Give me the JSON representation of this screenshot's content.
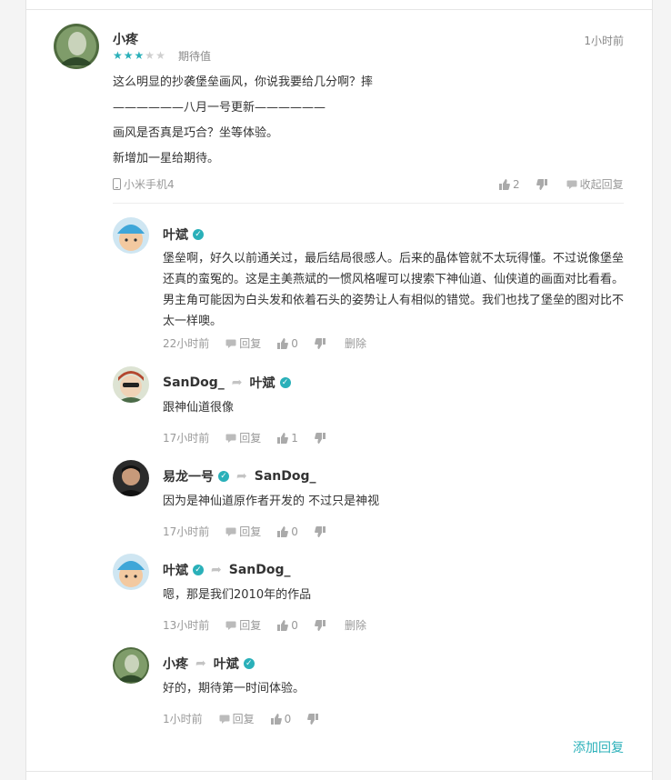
{
  "main_comment": {
    "author": "小疼",
    "time": "1小时前",
    "rating": 3,
    "rating_max": 5,
    "rating_label": "期待值",
    "lines": [
      "这么明显的抄袭堡垒画风，你说我要给几分啊？摔",
      "——————八月一号更新——————",
      "画风是否真是巧合？坐等体验。",
      "新增加一星给期待。"
    ],
    "device": "小米手机4",
    "likes": "2",
    "collapse_label": "收起回复"
  },
  "replies": [
    {
      "author": "叶斌",
      "verified_author": true,
      "target": "",
      "verified_target": false,
      "text": "堡垒啊，好久以前通关过，最后结局很感人。后来的晶体管就不太玩得懂。不过说像堡垒还真的蛮冤的。这是主美燕斌的一惯风格喔可以搜索下神仙道、仙侠道的画面对比看看。男主角可能因为白头发和依着石头的姿势让人有相似的错觉。我们也找了堡垒的图对比不太一样噢。",
      "time": "22小时前",
      "reply_label": "回复",
      "likes": "0",
      "delete_label": "删除"
    },
    {
      "author": "SanDog_",
      "verified_author": false,
      "target": "叶斌",
      "verified_target": true,
      "text": "跟神仙道很像",
      "time": "17小时前",
      "reply_label": "回复",
      "likes": "1",
      "delete_label": ""
    },
    {
      "author": "易龙一号",
      "verified_author": true,
      "target": "SanDog_",
      "verified_target": false,
      "text": "因为是神仙道原作者开发的 不过只是神视",
      "time": "17小时前",
      "reply_label": "回复",
      "likes": "0",
      "delete_label": ""
    },
    {
      "author": "叶斌",
      "verified_author": true,
      "target": "SanDog_",
      "verified_target": false,
      "text": "嗯，那是我们2010年的作品",
      "time": "13小时前",
      "reply_label": "回复",
      "likes": "0",
      "delete_label": "删除"
    },
    {
      "author": "小疼",
      "verified_author": false,
      "target": "叶斌",
      "verified_target": true,
      "text": "好的，期待第一时间体验。",
      "time": "1小时前",
      "reply_label": "回复",
      "likes": "0",
      "delete_label": ""
    }
  ],
  "add_reply_label": "添加回复",
  "colors": {
    "accent": "#2ab0b9",
    "meta": "#999999",
    "star_off": "#cfcfcf"
  }
}
